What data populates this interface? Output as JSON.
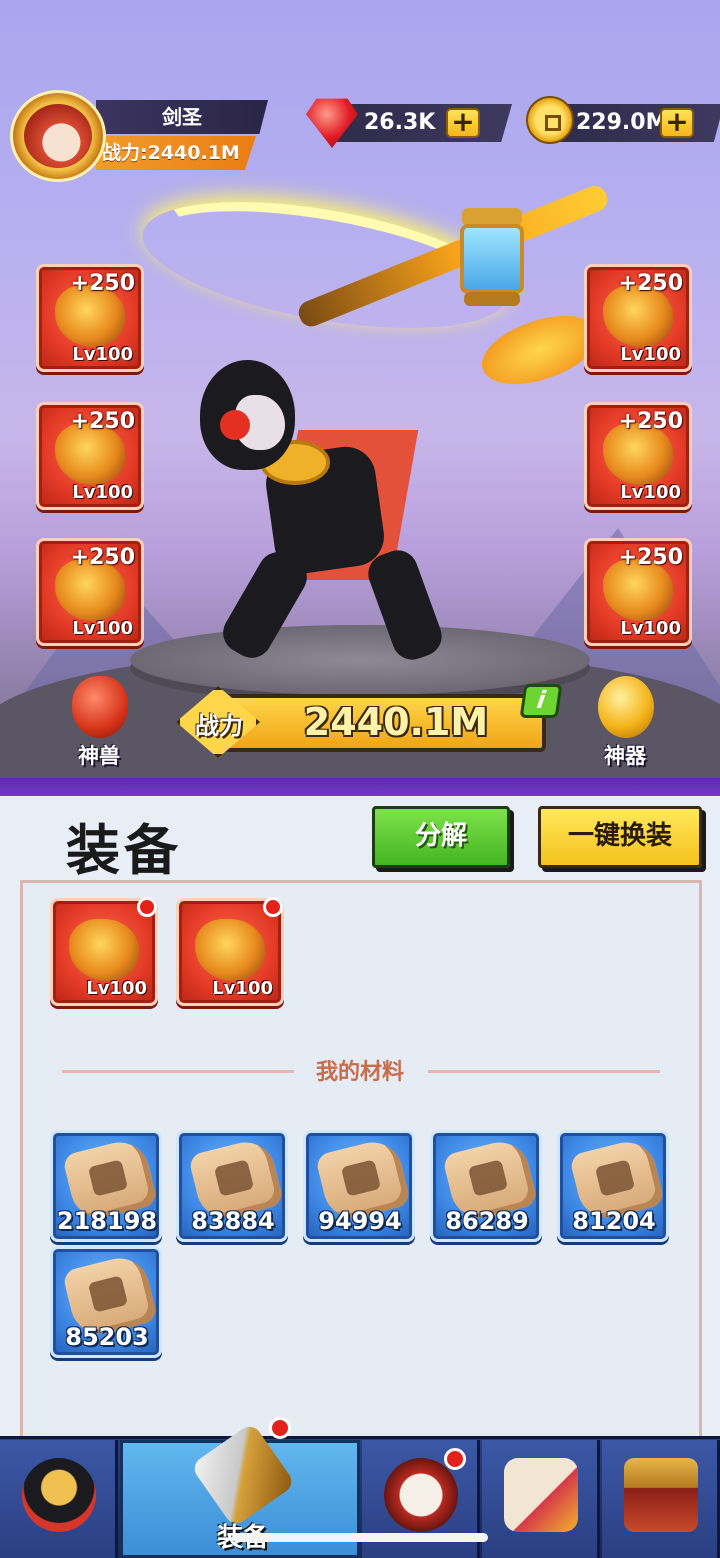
{
  "player": {
    "name": "剑圣",
    "power_text": "战力:2440.1M"
  },
  "currencies": {
    "gems": "26.3K",
    "gold": "229.0M",
    "plus_symbol": "+"
  },
  "equip_slots": {
    "left": [
      {
        "bonus": "+250",
        "level": "Lv100",
        "icon": "sword-icon"
      },
      {
        "bonus": "+250",
        "level": "Lv100",
        "icon": "armor-icon"
      },
      {
        "bonus": "+250",
        "level": "Lv100",
        "icon": "bracer-icon"
      }
    ],
    "right": [
      {
        "bonus": "+250",
        "level": "Lv100",
        "icon": "helmet-icon"
      },
      {
        "bonus": "+250",
        "level": "Lv100",
        "icon": "belt-icon"
      },
      {
        "bonus": "+250",
        "level": "Lv100",
        "icon": "amulet-icon"
      }
    ]
  },
  "power_banner": {
    "label": "战力",
    "value": "2440.1M",
    "info": "i"
  },
  "side_buttons": {
    "beast": "神兽",
    "artifact": "神器"
  },
  "panel": {
    "title": "装备",
    "decompose_button": "分解",
    "auto_equip_button": "一键换装",
    "inventory": [
      {
        "level": "Lv100",
        "icon": "sword-icon",
        "has_alert": true
      },
      {
        "level": "Lv100",
        "icon": "bracer-icon",
        "has_alert": true
      }
    ],
    "materials_label": "我的材料",
    "materials": [
      {
        "count": "218198",
        "icon": "sword-scroll-icon"
      },
      {
        "count": "83884",
        "icon": "armor-scroll-icon"
      },
      {
        "count": "94994",
        "icon": "bracer-scroll-icon"
      },
      {
        "count": "86289",
        "icon": "boot-scroll-icon"
      },
      {
        "count": "81204",
        "icon": "belt-scroll-icon"
      },
      {
        "count": "85203",
        "icon": "ring-scroll-icon"
      }
    ]
  },
  "nav": {
    "items": [
      {
        "label": "",
        "icon": "hero-icon"
      },
      {
        "label": "装备",
        "icon": "equipment-icon",
        "active": true,
        "has_alert": true
      },
      {
        "label": "",
        "icon": "drum-icon",
        "has_alert": true
      },
      {
        "label": "",
        "icon": "scroll-potion-icon"
      },
      {
        "label": "",
        "icon": "temple-icon"
      }
    ]
  },
  "colors": {
    "accent_red": "#e33a26",
    "accent_gold": "#f0a516",
    "material_blue": "#3d87e4",
    "green_button": "#44b522",
    "yellow_button": "#f5c21e"
  }
}
